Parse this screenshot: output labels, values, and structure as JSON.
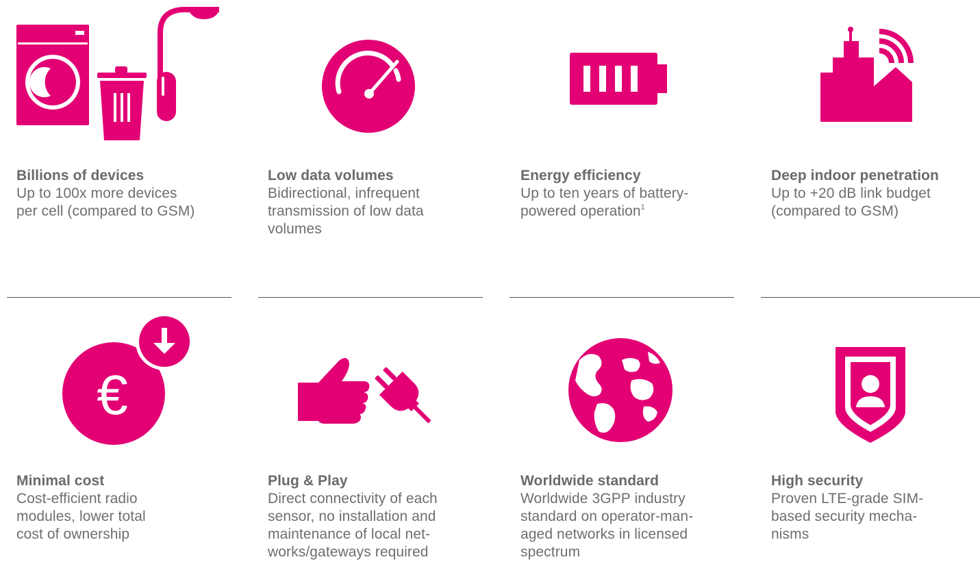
{
  "colors": {
    "accent": "#e20074",
    "text": "#6e6e6e",
    "divider": "#555555"
  },
  "features": [
    {
      "icon": "appliances-icon",
      "title": "Billions of devices",
      "desc_lines": [
        "Up to 100x more devices",
        "per cell (compared to GSM)"
      ]
    },
    {
      "icon": "speedometer-icon",
      "title": "Low data volumes",
      "desc_lines": [
        "Bidirectional, infrequent",
        "transmission of low data",
        "volumes"
      ]
    },
    {
      "icon": "battery-icon",
      "title": "Energy efficiency",
      "desc_lines": [
        "Up to ten years of battery-",
        "powered operation"
      ],
      "footnote": "1"
    },
    {
      "icon": "building-signal-icon",
      "title": "Deep indoor penetration",
      "desc_lines": [
        "Up to +20 dB link budget",
        "(compared to GSM)"
      ]
    },
    {
      "icon": "euro-cost-down-icon",
      "title": "Minimal cost",
      "desc_lines": [
        "Cost-efficient radio",
        "modules, lower total",
        "cost of ownership"
      ]
    },
    {
      "icon": "thumbs-up-plug-icon",
      "title": "Plug & Play",
      "desc_lines": [
        "Direct connectivity of each",
        "sensor, no installation and",
        "maintenance of local net-",
        "works/gateways required"
      ]
    },
    {
      "icon": "globe-icon",
      "title": "Worldwide standard",
      "desc_lines": [
        "Worldwide 3GPP industry",
        "standard on operator-man-",
        "aged networks in licensed",
        "spectrum"
      ]
    },
    {
      "icon": "shield-user-icon",
      "title": "High security",
      "desc_lines": [
        "Proven LTE-grade SIM-",
        "based security mecha-",
        "nisms"
      ]
    }
  ],
  "euro_symbol": "€"
}
